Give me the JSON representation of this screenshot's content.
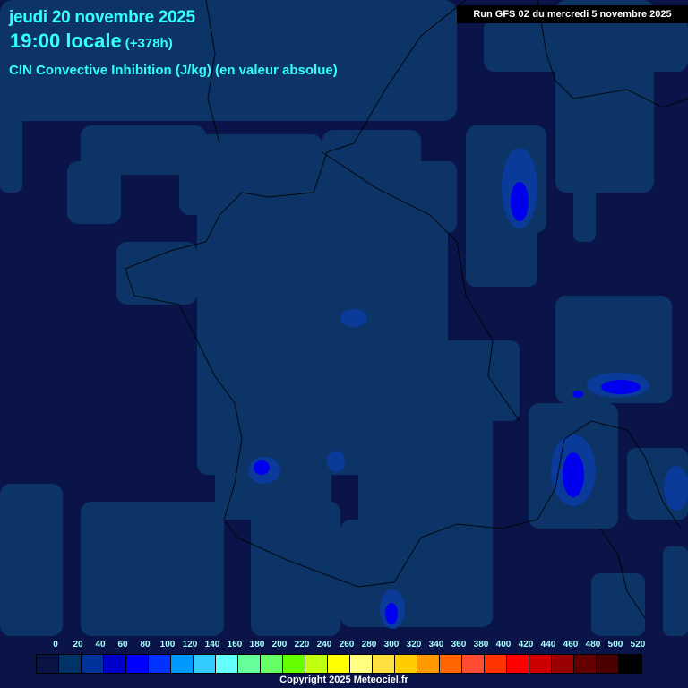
{
  "header": {
    "date": "jeudi 20 novembre 2025",
    "time": "19:00 locale",
    "offset": "(+378h)",
    "parameter": "CIN Convective Inhibition (J/kg) (en valeur absolue)",
    "run": "Run GFS 0Z du mercredi 5 novembre 2025"
  },
  "legend": {
    "labels": [
      "0",
      "20",
      "40",
      "60",
      "80",
      "100",
      "120",
      "140",
      "160",
      "180",
      "200",
      "220",
      "240",
      "260",
      "280",
      "300",
      "320",
      "340",
      "360",
      "380",
      "400",
      "420",
      "440",
      "460",
      "480",
      "500",
      "520"
    ],
    "colors": [
      "#0a1444",
      "#003366",
      "#003399",
      "#0000cc",
      "#0000ff",
      "#0033ff",
      "#0099ff",
      "#33ccff",
      "#66ffff",
      "#66ff99",
      "#66ff66",
      "#66ff00",
      "#c0ff10",
      "#ffff00",
      "#ffff80",
      "#ffe040",
      "#ffcc00",
      "#ff9900",
      "#ff6600",
      "#ff4c33",
      "#ff3300",
      "#ff0000",
      "#cc0000",
      "#990000",
      "#660000",
      "#4c0000",
      "#000000"
    ]
  },
  "colors": {
    "background": "#0a1448",
    "low": "#0c3466",
    "mid": "#0a3a9a",
    "high": "#0000ee"
  },
  "copyright": "Copyright 2025 Meteociel.fr"
}
